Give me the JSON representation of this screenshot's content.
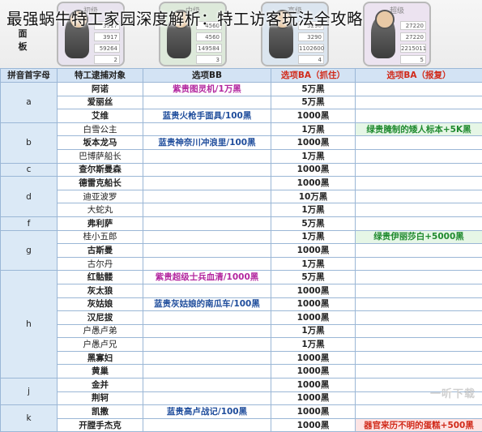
{
  "title": "最强蜗牛特工家园深度解析：特工访客玩法全攻略",
  "panel": {
    "label": "面板",
    "levels": [
      "初级",
      "中级",
      "高级",
      "超级"
    ],
    "stats": [
      [
        "3917",
        "4560",
        "3290",
        "27220"
      ],
      [
        "3917",
        "4560",
        "3290",
        "27220"
      ],
      [
        "59264",
        "149584",
        "1102600",
        "2215011"
      ],
      [
        "2",
        "3",
        "4",
        "5"
      ]
    ]
  },
  "table": {
    "headers": [
      "拼音首字母",
      "特工逮捕对象",
      "选项BB",
      "选项BA（抓住）",
      "选项BA（报复）"
    ],
    "groups": [
      {
        "letter": "a",
        "rows": [
          {
            "name": "阿诺",
            "name_color": "purple",
            "bb": "紫贵图灵机/1万黑",
            "bb_color": "purple",
            "ba": "5万黑",
            "rev": ""
          },
          {
            "name": "爱丽丝",
            "name_color": "purple",
            "bb": "",
            "bb_color": "",
            "ba": "5万黑",
            "rev": ""
          },
          {
            "name": "艾维",
            "name_color": "blue",
            "bb": "蓝贵火枪手面具/100黑",
            "bb_color": "blue",
            "ba": "1000黑",
            "rev": ""
          }
        ]
      },
      {
        "letter": "b",
        "rows": [
          {
            "name": "白雪公主",
            "name_color": "black",
            "bb": "",
            "bb_color": "",
            "ba": "1万黑",
            "rev": "绿贵腌制的矮人标本+5K黑",
            "rev_color": "green"
          },
          {
            "name": "坂本龙马",
            "name_color": "blue",
            "bb": "蓝贵神奈川冲浪里/100黑",
            "bb_color": "blue",
            "ba": "1000黑",
            "rev": ""
          },
          {
            "name": "巴博萨船长",
            "name_color": "black",
            "bb": "",
            "bb_color": "",
            "ba": "1万黑",
            "rev": ""
          }
        ]
      },
      {
        "letter": "c",
        "rows": [
          {
            "name": "查尔斯曼森",
            "name_color": "green",
            "bb": "",
            "bb_color": "",
            "ba": "1000黑",
            "rev": ""
          }
        ]
      },
      {
        "letter": "d",
        "rows": [
          {
            "name": "德雷克船长",
            "name_color": "green",
            "bb": "",
            "bb_color": "",
            "ba": "1000黑",
            "rev": ""
          },
          {
            "name": "迪亚波罗",
            "name_color": "orange",
            "bb": "",
            "bb_color": "",
            "ba": "10万黑",
            "rev": ""
          },
          {
            "name": "大蛇丸",
            "name_color": "black",
            "bb": "",
            "bb_color": "",
            "ba": "1万黑",
            "rev": ""
          }
        ]
      },
      {
        "letter": "f",
        "rows": [
          {
            "name": "弗利萨",
            "name_color": "purple",
            "bb": "",
            "bb_color": "",
            "ba": "5万黑",
            "rev": ""
          }
        ]
      },
      {
        "letter": "g",
        "rows": [
          {
            "name": "桂小五郎",
            "name_color": "black",
            "bb": "",
            "bb_color": "",
            "ba": "1万黑",
            "rev": "绿贵伊丽莎白+5000黑",
            "rev_color": "green"
          },
          {
            "name": "古斯曼",
            "name_color": "green",
            "bb": "",
            "bb_color": "",
            "ba": "1000黑",
            "rev": ""
          },
          {
            "name": "古尔丹",
            "name_color": "black",
            "bb": "",
            "bb_color": "",
            "ba": "1万黑",
            "rev": ""
          }
        ]
      },
      {
        "letter": "h",
        "rows": [
          {
            "name": "红骷髅",
            "name_color": "purple",
            "bb": "紫贵超级士兵血清/1000黑",
            "bb_color": "purple",
            "ba": "5万黑",
            "rev": ""
          },
          {
            "name": "灰太狼",
            "name_color": "blue",
            "bb": "",
            "bb_color": "",
            "ba": "1000黑",
            "rev": ""
          },
          {
            "name": "灰姑娘",
            "name_color": "blue",
            "bb": "蓝贵灰姑娘的南瓜车/100黑",
            "bb_color": "blue",
            "ba": "1000黑",
            "rev": ""
          },
          {
            "name": "汉尼拔",
            "name_color": "green",
            "bb": "",
            "bb_color": "",
            "ba": "1000黑",
            "rev": ""
          },
          {
            "name": "户愚卢弟",
            "name_color": "black",
            "bb": "",
            "bb_color": "",
            "ba": "1万黑",
            "rev": ""
          },
          {
            "name": "户愚卢兄",
            "name_color": "black",
            "bb": "",
            "bb_color": "",
            "ba": "1万黑",
            "rev": ""
          },
          {
            "name": "黑寡妇",
            "name_color": "green",
            "bb": "",
            "bb_color": "",
            "ba": "1000黑",
            "rev": ""
          },
          {
            "name": "黄巢",
            "name_color": "green",
            "bb": "",
            "bb_color": "",
            "ba": "1000黑",
            "rev": ""
          }
        ]
      },
      {
        "letter": "j",
        "rows": [
          {
            "name": "金并",
            "name_color": "green",
            "bb": "",
            "bb_color": "",
            "ba": "1000黑",
            "rev": ""
          },
          {
            "name": "荆轲",
            "name_color": "green",
            "bb": "",
            "bb_color": "",
            "ba": "1000黑",
            "rev": ""
          }
        ]
      },
      {
        "letter": "k",
        "rows": [
          {
            "name": "凯撒",
            "name_color": "blue",
            "bb": "蓝贵高卢战记/100黑",
            "bb_color": "blue",
            "ba": "1000黑",
            "rev": ""
          },
          {
            "name": "开膛手杰克",
            "name_color": "blue",
            "bb": "",
            "bb_color": "",
            "ba": "1000黑",
            "rev": "器官来历不明的蛋糕+500黑",
            "rev_color": "red"
          }
        ]
      }
    ]
  },
  "watermark": "一听下载"
}
